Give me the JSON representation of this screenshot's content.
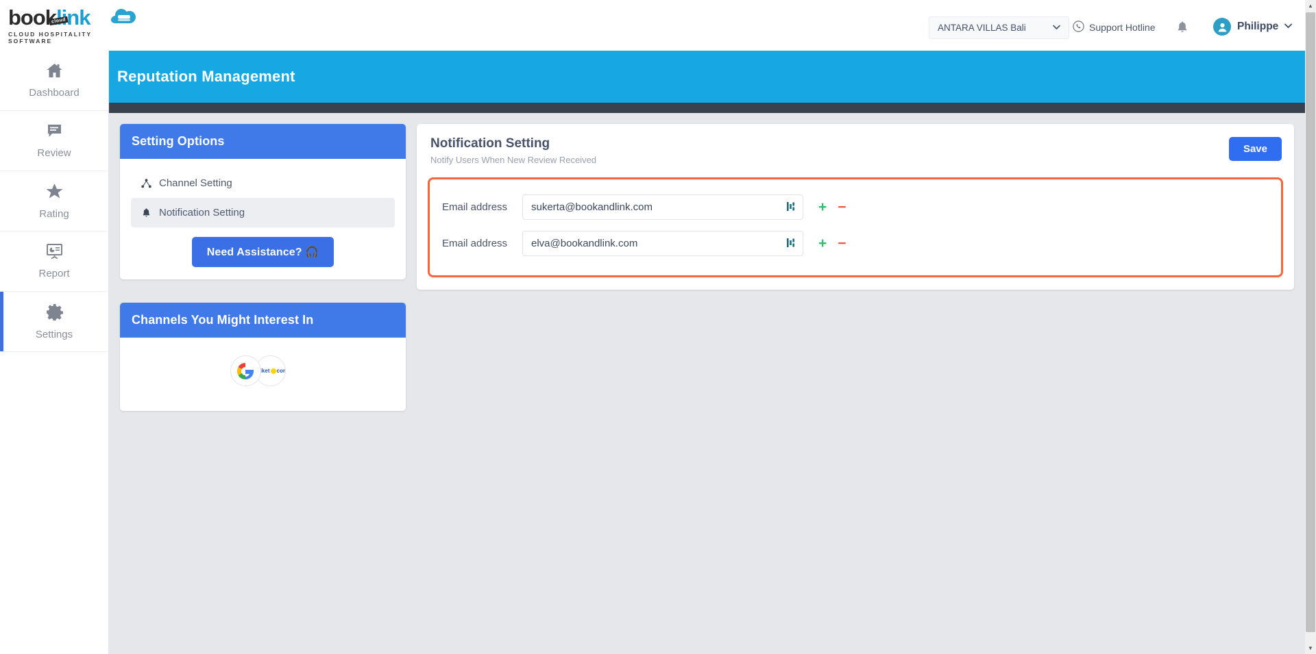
{
  "brand": {
    "logo_text_1": "book",
    "logo_text_2": "link",
    "logo_badge": "cloud",
    "logo_tagline": "CLOUD HOSPITALITY SOFTWARE"
  },
  "topbar": {
    "hotel_selected": "ANTARA VILLAS Bali",
    "support_label": "Support Hotline",
    "user_name": "Philippe",
    "chevron": "⌄"
  },
  "sidebar": {
    "items": [
      {
        "label": "Dashboard",
        "icon": "home-icon",
        "active": false
      },
      {
        "label": "Review",
        "icon": "comment-icon",
        "active": false
      },
      {
        "label": "Rating",
        "icon": "star-icon",
        "active": false
      },
      {
        "label": "Report",
        "icon": "presentation-chart-icon",
        "active": false
      },
      {
        "label": "Settings",
        "icon": "gear-icon",
        "active": true
      }
    ]
  },
  "page": {
    "title": "Reputation Management"
  },
  "setting_options": {
    "header": "Setting Options",
    "items": [
      {
        "label": "Channel Setting",
        "icon": "sitemap-icon",
        "selected": false
      },
      {
        "label": "Notification Setting",
        "icon": "bell-icon",
        "selected": true
      }
    ],
    "assistance_label": "Need Assistance? 🎧"
  },
  "channels": {
    "header": "Channels You Might Interest In",
    "logos": [
      {
        "name": "google-logo",
        "label": "G"
      },
      {
        "name": "tiket-com-logo",
        "label": "tiket.com"
      }
    ]
  },
  "notification": {
    "title": "Notification Setting",
    "subtitle": "Notify Users When New Review Received",
    "save_label": "Save",
    "rows": [
      {
        "label": "Email address",
        "value": "sukerta@bookandlink.com",
        "placeholder": "Email address",
        "add": "+",
        "remove": "−"
      },
      {
        "label": "Email address",
        "value": "elva@bookandlink.com",
        "placeholder": "Email address",
        "add": "+",
        "remove": "−"
      }
    ]
  },
  "colors": {
    "banner": "#17a8e3",
    "panel_header": "#3f7ae8",
    "primary_button": "#2f6ef0",
    "highlight_border": "#f2683a",
    "add_green": "#2fbf6f",
    "remove_red": "#f2544a"
  }
}
